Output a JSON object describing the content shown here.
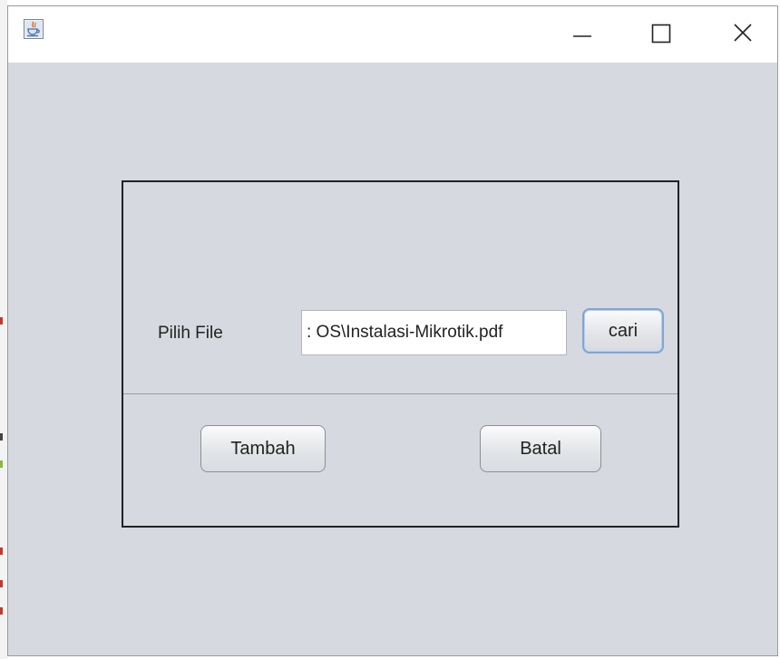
{
  "window": {
    "app_icon": "java-coffee-cup-icon",
    "controls": {
      "minimize_icon": "minimize-icon",
      "maximize_icon": "maximize-icon",
      "close_icon": "close-icon"
    }
  },
  "form": {
    "file_label": "Pilih File",
    "file_path_value": ": OS\\Instalasi-Mikrotik.pdf",
    "browse_button": "cari",
    "add_button": "Tambah",
    "cancel_button": "Batal"
  },
  "colors": {
    "window_background": "#d6d9df",
    "titlebar_background": "#ffffff",
    "panel_border": "#222222",
    "focus_border": "#7ea6d4"
  }
}
